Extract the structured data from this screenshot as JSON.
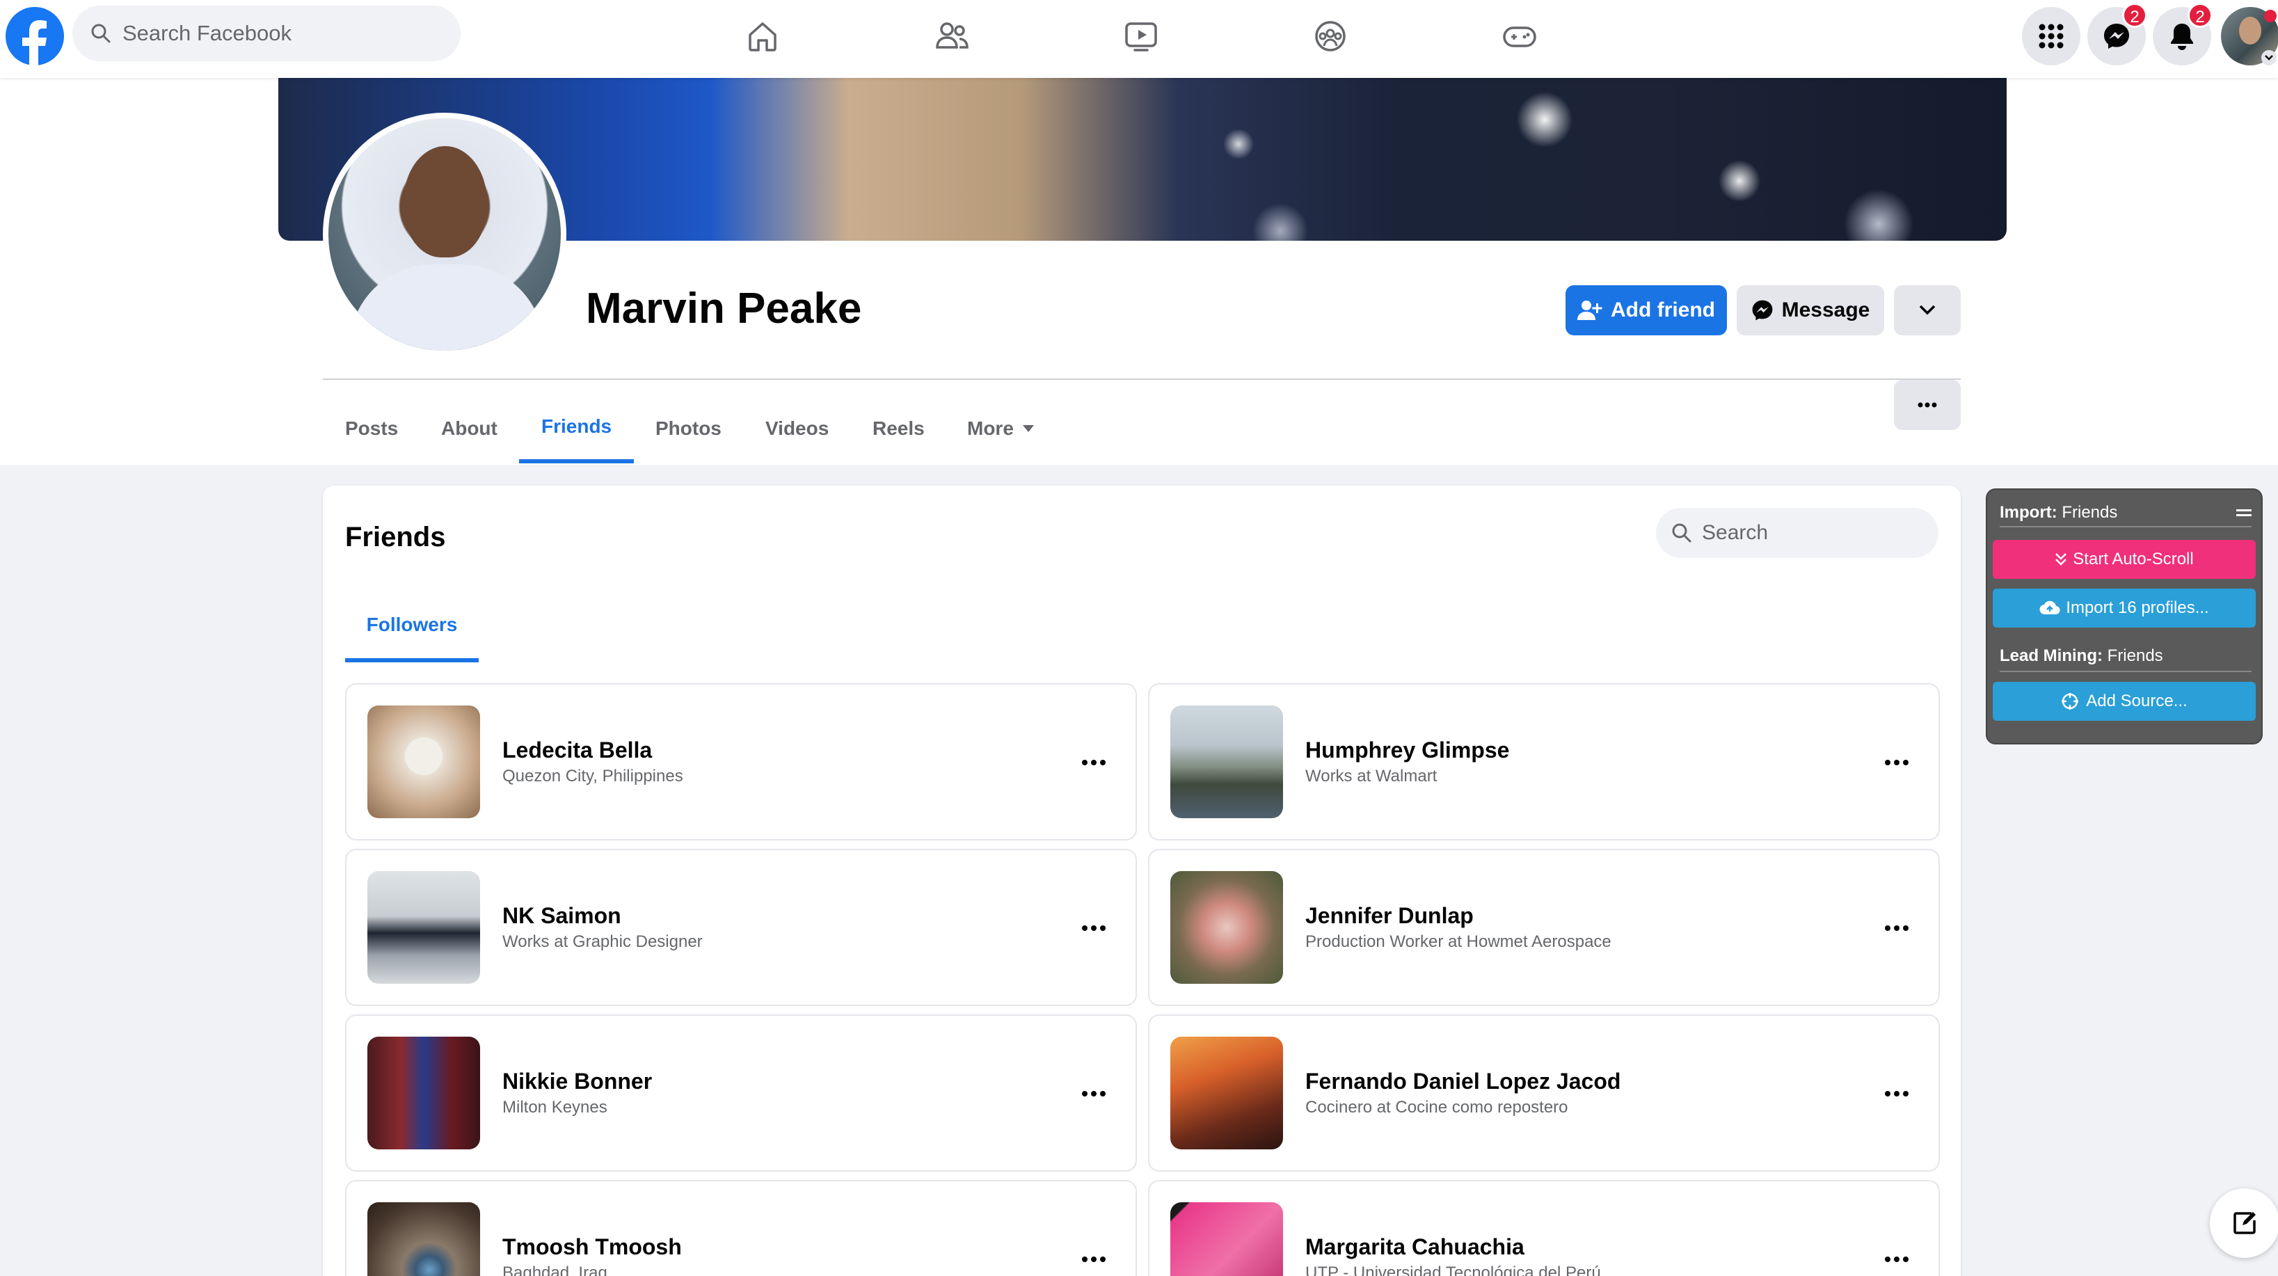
{
  "topnav": {
    "search_placeholder": "Search Facebook",
    "messenger_badge": "2",
    "notifications_badge": "2"
  },
  "profile": {
    "name": "Marvin Peake",
    "add_friend_label": "Add friend",
    "message_label": "Message",
    "tabs": [
      "Posts",
      "About",
      "Friends",
      "Photos",
      "Videos",
      "Reels",
      "More"
    ],
    "active_tab": "Friends"
  },
  "friends": {
    "title": "Friends",
    "search_placeholder": "Search",
    "subtab": "Followers",
    "list": [
      {
        "name": "Ledecita Bella",
        "subtitle": "Quezon City, Philippines"
      },
      {
        "name": "Humphrey Glimpse",
        "subtitle": "Works at Walmart"
      },
      {
        "name": "NK Saimon",
        "subtitle": "Works at Graphic Designer"
      },
      {
        "name": "Jennifer Dunlap",
        "subtitle": "Production Worker at Howmet Aerospace"
      },
      {
        "name": "Nikkie Bonner",
        "subtitle": "Milton Keynes"
      },
      {
        "name": "Fernando Daniel Lopez Jacod",
        "subtitle": "Cocinero at Cocine como repostero"
      },
      {
        "name": "Tmoosh Tmoosh",
        "subtitle": "Baghdad, Iraq"
      },
      {
        "name": "Margarita Cahuachia",
        "subtitle": "UTP - Universidad Tecnológica del Perú"
      }
    ]
  },
  "extension": {
    "import_prefix": "Import:",
    "import_target": "Friends",
    "start_autoscroll": "Start Auto-Scroll",
    "import_profiles": "Import 16 profiles...",
    "lead_prefix": "Lead Mining:",
    "lead_target": "Friends",
    "add_source": "Add Source..."
  },
  "colors": {
    "brand_blue": "#1b74e4",
    "ext_pink": "#f0307a",
    "ext_blue": "#2a9fd8",
    "badge_red": "#e41e3f"
  }
}
